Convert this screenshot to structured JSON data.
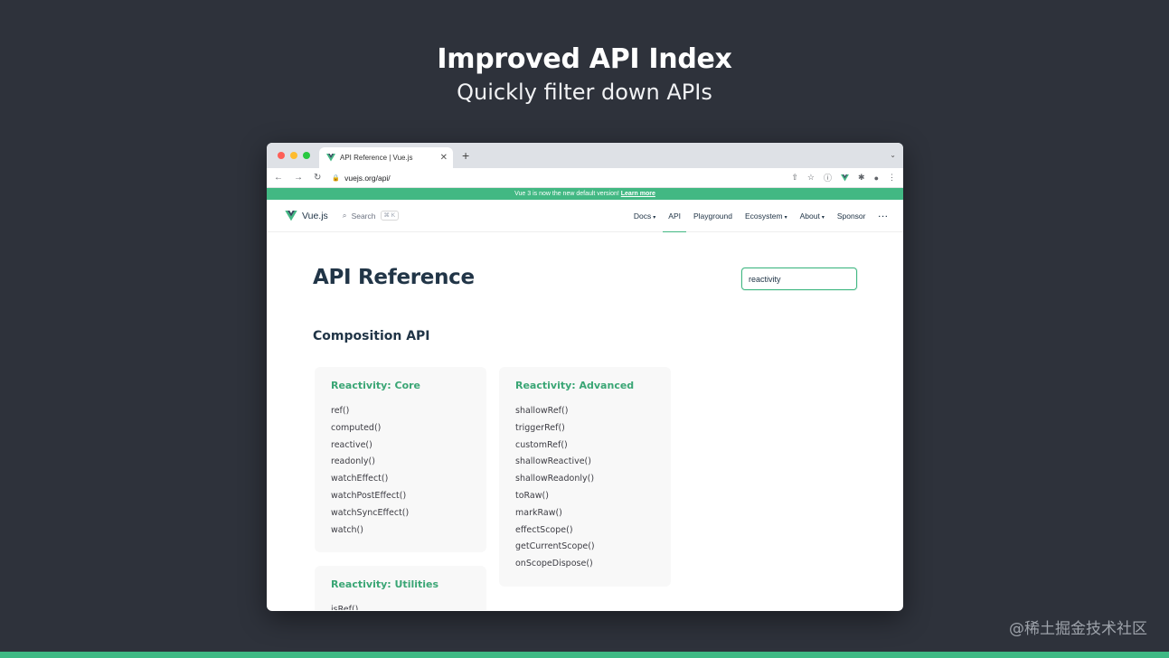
{
  "slide": {
    "title": "Improved API Index",
    "subtitle": "Quickly filter down APIs",
    "watermark": "@稀土掘金技术社区",
    "accent_color": "#3fb984"
  },
  "browser": {
    "tab_title": "API Reference | Vue.js",
    "tab_close": "✕",
    "new_tab": "+",
    "url": "vuejs.org/api/",
    "nav_back": "←",
    "nav_forward": "→",
    "nav_reload": "↻",
    "icons": [
      "share-icon",
      "bookmark-star-icon",
      "info-icon",
      "vue-devtools-icon",
      "extensions-icon",
      "profile-icon",
      "menu-kebab-icon"
    ]
  },
  "banner": {
    "text": "Vue 3 is now the new default version!",
    "link": "Learn more",
    "color": "#42b883"
  },
  "site_nav": {
    "logo": "Vue.js",
    "search_label": "Search",
    "search_shortcut": "⌘ K",
    "links": [
      {
        "label": "Docs",
        "dropdown": true
      },
      {
        "label": "API",
        "active": true
      },
      {
        "label": "Playground"
      },
      {
        "label": "Ecosystem",
        "dropdown": true
      },
      {
        "label": "About",
        "dropdown": true
      },
      {
        "label": "Sponsor"
      }
    ],
    "more": "···"
  },
  "page": {
    "title": "API Reference",
    "filter_value": "reactivity",
    "section_title": "Composition API",
    "groups": [
      {
        "title": "Reactivity: Core",
        "items": [
          "ref()",
          "computed()",
          "reactive()",
          "readonly()",
          "watchEffect()",
          "watchPostEffect()",
          "watchSyncEffect()",
          "watch()"
        ]
      },
      {
        "title": "Reactivity: Advanced",
        "items": [
          "shallowRef()",
          "triggerRef()",
          "customRef()",
          "shallowReactive()",
          "shallowReadonly()",
          "toRaw()",
          "markRaw()",
          "effectScope()",
          "getCurrentScope()",
          "onScopeDispose()"
        ]
      },
      {
        "title": "Reactivity: Utilities",
        "items": [
          "isRef()"
        ]
      }
    ]
  }
}
